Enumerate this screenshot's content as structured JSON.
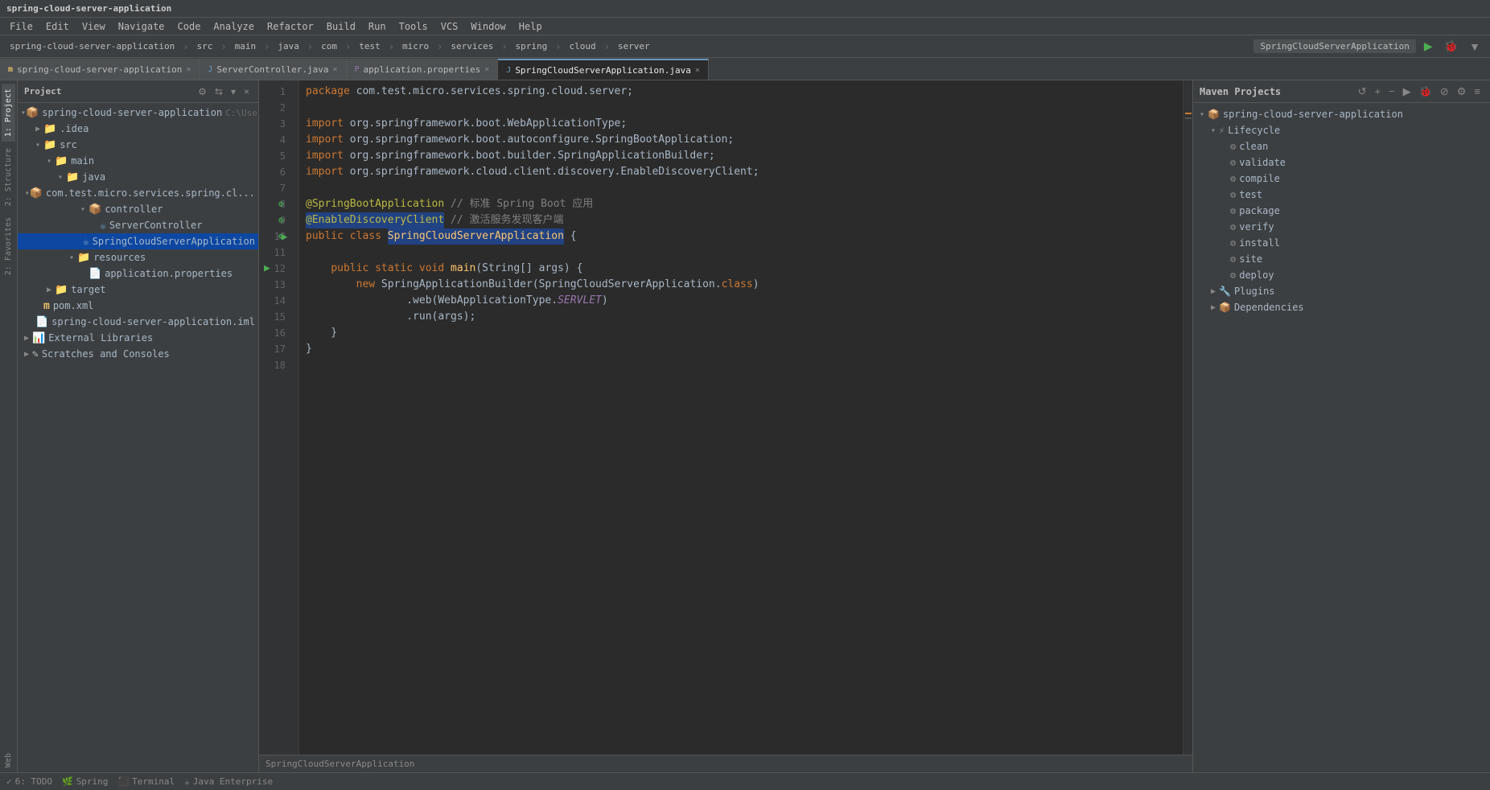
{
  "titleBar": {
    "title": "spring-cloud-server-application"
  },
  "menuBar": {
    "items": [
      "File",
      "Edit",
      "View",
      "Navigate",
      "Code",
      "Analyze",
      "Refactor",
      "Build",
      "Run",
      "Tools",
      "VCS",
      "Window",
      "Help"
    ]
  },
  "projectToolbar": {
    "items": [
      "spring-cloud-server-application",
      "src",
      "main",
      "java",
      "com",
      "test",
      "micro",
      "services",
      "spring",
      "cloud",
      "server"
    ],
    "runConfig": "SpringCloudServerApplication"
  },
  "tabs": [
    {
      "label": "spring-cloud-server-application",
      "icon": "m",
      "active": false,
      "closeable": true
    },
    {
      "label": "ServerController.java",
      "icon": "J",
      "active": false,
      "closeable": true
    },
    {
      "label": "application.properties",
      "icon": "P",
      "active": false,
      "closeable": true
    },
    {
      "label": "SpringCloudServerApplication.java",
      "icon": "J",
      "active": true,
      "closeable": true
    }
  ],
  "projectPanel": {
    "title": "Project",
    "tree": [
      {
        "level": 0,
        "label": "spring-cloud-server-application",
        "type": "module",
        "expanded": true,
        "extra": "C:\\Users\\Admin..."
      },
      {
        "level": 1,
        "label": ".idea",
        "type": "folder",
        "expanded": false
      },
      {
        "level": 1,
        "label": "src",
        "type": "folder",
        "expanded": true
      },
      {
        "level": 2,
        "label": "main",
        "type": "folder",
        "expanded": true
      },
      {
        "level": 3,
        "label": "java",
        "type": "folder-src",
        "expanded": true
      },
      {
        "level": 4,
        "label": "com.test.micro.services.spring.cl...",
        "type": "package",
        "expanded": true
      },
      {
        "level": 5,
        "label": "controller",
        "type": "folder",
        "expanded": true
      },
      {
        "level": 6,
        "label": "ServerController",
        "type": "java",
        "expanded": false
      },
      {
        "level": 6,
        "label": "SpringCloudServerApplication",
        "type": "java",
        "expanded": false,
        "selected": true
      },
      {
        "level": 4,
        "label": "resources",
        "type": "folder-res",
        "expanded": true
      },
      {
        "level": 5,
        "label": "application.properties",
        "type": "props",
        "expanded": false
      },
      {
        "level": 2,
        "label": "target",
        "type": "folder",
        "expanded": false
      },
      {
        "level": 1,
        "label": "pom.xml",
        "type": "xml",
        "expanded": false
      },
      {
        "level": 1,
        "label": "spring-cloud-server-application.iml",
        "type": "iml",
        "expanded": false
      },
      {
        "level": 0,
        "label": "External Libraries",
        "type": "folder",
        "expanded": false
      },
      {
        "level": 0,
        "label": "Scratches and Consoles",
        "type": "scratches",
        "expanded": false
      }
    ]
  },
  "editor": {
    "filename": "SpringCloudServerApplication.java",
    "bottomLabel": "SpringCloudServerApplication",
    "lines": [
      {
        "num": 1,
        "text": "package com.test.micro.services.spring.cloud.server;"
      },
      {
        "num": 2,
        "text": ""
      },
      {
        "num": 3,
        "text": "import org.springframework.boot.WebApplicationType;"
      },
      {
        "num": 4,
        "text": "import org.springframework.boot.autoconfigure.SpringBootApplication;"
      },
      {
        "num": 5,
        "text": "import org.springframework.boot.builder.SpringApplicationBuilder;"
      },
      {
        "num": 6,
        "text": "import org.springframework.cloud.client.discovery.EnableDiscoveryClient;"
      },
      {
        "num": 7,
        "text": ""
      },
      {
        "num": 8,
        "text": "@SpringBootApplication // 标准 Spring Boot 应用"
      },
      {
        "num": 9,
        "text": "@EnableDiscoveryClient // 激活服务发现客户端"
      },
      {
        "num": 10,
        "text": "public class SpringCloudServerApplication {"
      },
      {
        "num": 11,
        "text": ""
      },
      {
        "num": 12,
        "text": "    public static void main(String[] args) {"
      },
      {
        "num": 13,
        "text": "        new SpringApplicationBuilder(SpringCloudServerApplication.class)"
      },
      {
        "num": 14,
        "text": "                .web(WebApplicationType.SERVLET)"
      },
      {
        "num": 15,
        "text": "                .run(args);"
      },
      {
        "num": 16,
        "text": "    }"
      },
      {
        "num": 17,
        "text": "}"
      },
      {
        "num": 18,
        "text": ""
      }
    ]
  },
  "mavenPanel": {
    "title": "Maven Projects",
    "projectName": "spring-cloud-server-application",
    "lifecycle": {
      "label": "Lifecycle",
      "items": [
        "clean",
        "validate",
        "compile",
        "test",
        "package",
        "verify",
        "install",
        "site",
        "deploy"
      ]
    },
    "plugins": {
      "label": "Plugins",
      "expanded": false
    },
    "dependencies": {
      "label": "Dependencies",
      "expanded": false
    }
  },
  "statusBar": {
    "items": [
      {
        "icon": "✓",
        "label": "6: TODO"
      },
      {
        "icon": "🌿",
        "label": "Spring"
      },
      {
        "icon": "⬛",
        "label": "Terminal"
      },
      {
        "icon": "☕",
        "label": "Java Enterprise"
      }
    ]
  },
  "sidePanel": {
    "tabs": [
      "1: Project",
      "2: Structure",
      "2: Favorites",
      "Web"
    ]
  }
}
